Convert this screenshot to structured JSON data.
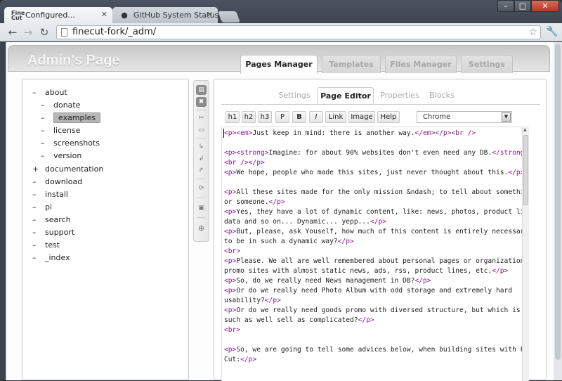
{
  "browser": {
    "tabs": [
      {
        "title": "Configured...",
        "favicon": "Fine Cut"
      },
      {
        "title": "GitHub System Status",
        "favicon": "github-icon"
      }
    ],
    "url_host": "finecut-fork/",
    "url_path": "_adm/"
  },
  "header": {
    "title": "Admin's Page",
    "tabs": [
      "Pages Manager",
      "Templates",
      "Files Manager",
      "Settings"
    ],
    "active_tab": "Pages Manager"
  },
  "tree": {
    "items": [
      {
        "toggle": "–",
        "label": "about"
      },
      {
        "toggle": "–",
        "label": "donate"
      },
      {
        "toggle": "–",
        "label": "examples"
      },
      {
        "toggle": "–",
        "label": "license"
      },
      {
        "toggle": "–",
        "label": "screenshots"
      },
      {
        "toggle": "–",
        "label": "version"
      },
      {
        "toggle": "+",
        "label": "documentation"
      },
      {
        "toggle": "–",
        "label": "download"
      },
      {
        "toggle": "–",
        "label": "install"
      },
      {
        "toggle": "–",
        "label": "pi"
      },
      {
        "toggle": "–",
        "label": "search"
      },
      {
        "toggle": "–",
        "label": "support"
      },
      {
        "toggle": "–",
        "label": "test"
      },
      {
        "toggle": "–",
        "label": "_index"
      }
    ],
    "selected": "examples"
  },
  "editor": {
    "tabs": [
      "Settings",
      "Page Editor",
      "Properties",
      "Blocks"
    ],
    "active_tab": "Page Editor",
    "format_buttons": [
      "h1",
      "h2",
      "h3",
      "P",
      "B",
      "I",
      "Link",
      "Image",
      "Help"
    ],
    "theme": "Chrome",
    "code_lines": [
      "<p><em>Just keep in mind: there is another way.</em></p><br />",
      "",
      "<p><strong>Imagine: for about 90% websites don't even need any DB.</strong>",
      "<br /></p>",
      "<p>We hope, people who made this sites, just never thought about this.</p>",
      "",
      "<p>All these sites made for the only mission &ndash; to tell about something",
      "or someone.</p>",
      "<p>Yes, they have a lot of dynamic content, like: news, photos, product line",
      "data and so on... Dynamic... yepp...</p>",
      "<p>But, please, ask Youself, how much of this content is entirely necessary",
      "to be in such a dynamic way?</p>",
      "<br>",
      "<p>Please. We all are well remembered about personal pages or organization",
      "promo sites with almost static news, ads, rss, product lines, etc.</p>",
      "<p>So, do we really need News management in DB?</p>",
      "<p>Or do we really need Photo Album with odd storage and extremely hard",
      "usability?</p>",
      "<p>Or do we really need goods promo with diversed structure, but which is not",
      "such as well sell as complicated?</p>",
      "<br>",
      "",
      "<p>So, we are going to tell some advices below, when building sites with Fine",
      "Cut:</p>"
    ]
  },
  "colors": {
    "tag": "#8b1a8b",
    "selected_node": "#b7b7b7"
  }
}
